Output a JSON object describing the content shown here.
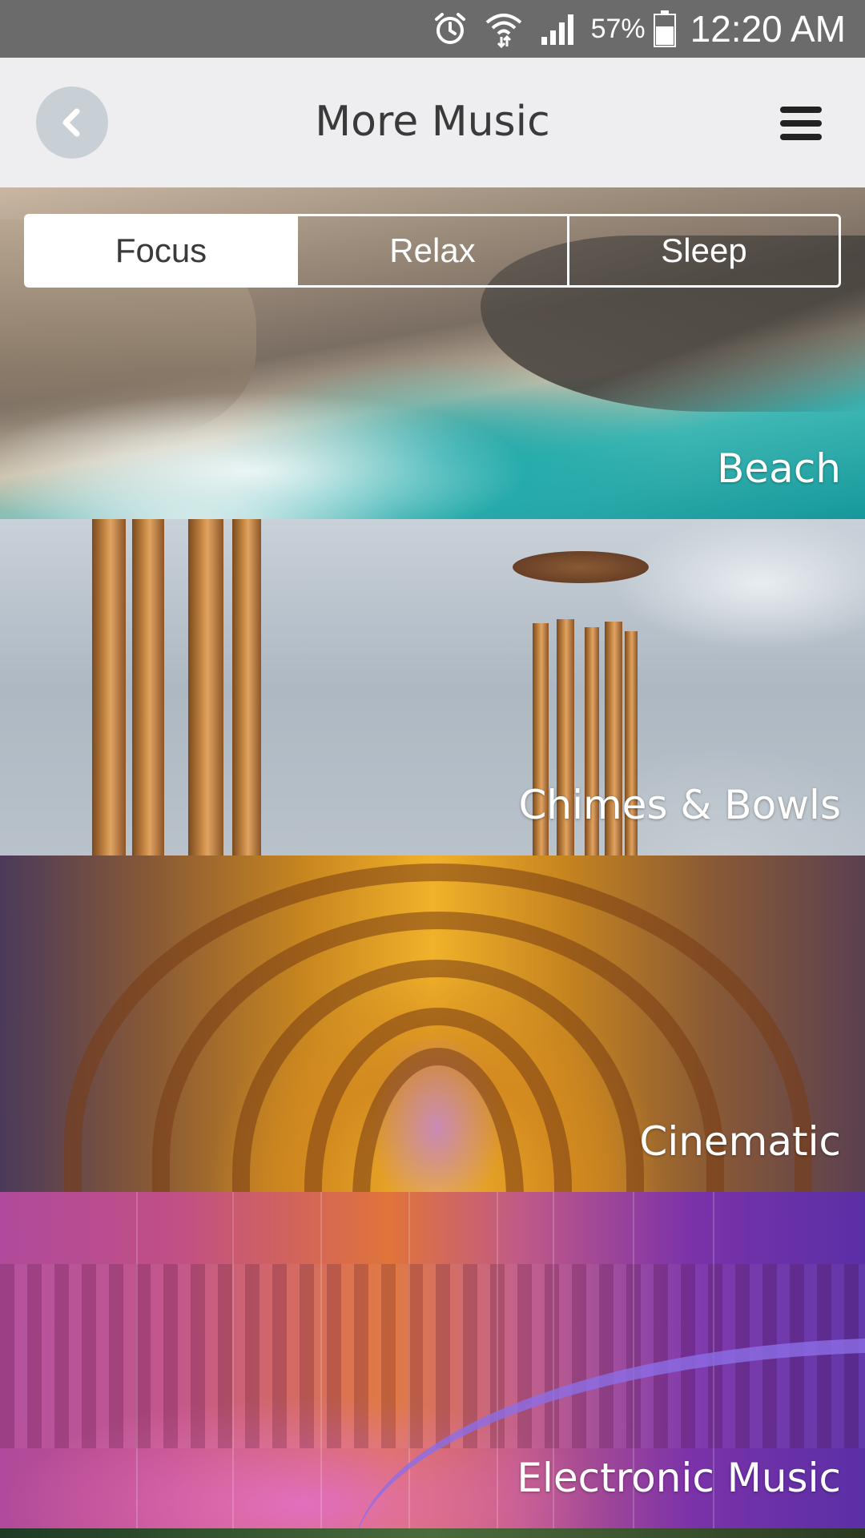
{
  "status_bar": {
    "battery_percent": "57%",
    "time": "12:20 AM",
    "icons": [
      "alarm-icon",
      "wifi-icon",
      "signal-icon",
      "battery-icon"
    ]
  },
  "header": {
    "title": "More Music",
    "back_icon": "chevron-left-icon",
    "menu_icon": "hamburger-menu-icon"
  },
  "tabs": [
    {
      "label": "Focus",
      "active": true
    },
    {
      "label": "Relax",
      "active": false
    },
    {
      "label": "Sleep",
      "active": false
    }
  ],
  "categories": [
    {
      "label": "Beach"
    },
    {
      "label": "Chimes & Bowls"
    },
    {
      "label": "Cinematic"
    },
    {
      "label": "Electronic Music"
    }
  ],
  "colors": {
    "status_bar": "#6b6b6b",
    "header_bg": "#eeeef0",
    "back_button_bg": "#c8cfd5",
    "title_text": "#3a3a3a"
  }
}
